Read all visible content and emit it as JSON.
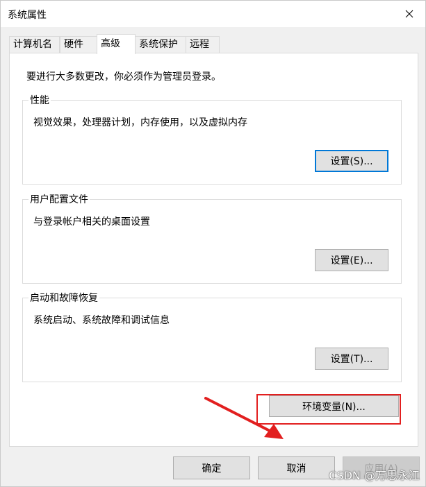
{
  "window": {
    "title": "系统属性"
  },
  "tabs": [
    {
      "label": "计算机名"
    },
    {
      "label": "硬件"
    },
    {
      "label": "高级"
    },
    {
      "label": "系统保护"
    },
    {
      "label": "远程"
    }
  ],
  "active_tab": "高级",
  "notice": "要进行大多数更改，你必须作为管理员登录。",
  "groups": {
    "performance": {
      "label": "性能",
      "desc": "视觉效果，处理器计划，内存使用，以及虚拟内存",
      "button": "设置(S)..."
    },
    "profiles": {
      "label": "用户配置文件",
      "desc": "与登录帐户相关的桌面设置",
      "button": "设置(E)..."
    },
    "startup": {
      "label": "启动和故障恢复",
      "desc": "系统启动、系统故障和调试信息",
      "button": "设置(T)..."
    }
  },
  "env_button": "环境变量(N)...",
  "footer": {
    "ok": "确定",
    "cancel": "取消",
    "apply": "应用(A)"
  },
  "watermark": "CSDN @万思永江",
  "colors": {
    "highlight": "#e21f1f",
    "focus": "#0078d7",
    "window_bg": "#f0f0f0"
  },
  "icons": {
    "close": "close-icon",
    "annotation_arrow": "red-arrow-icon"
  }
}
